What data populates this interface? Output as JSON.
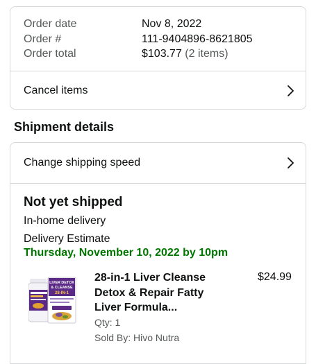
{
  "order_summary": {
    "rows": [
      {
        "label": "Order date",
        "value": "Nov 8, 2022"
      },
      {
        "label": "Order #",
        "value": "111-9404896-8621805"
      },
      {
        "label": "Order total",
        "value": "$103.77",
        "extra": "(2 items)"
      }
    ],
    "cancel_label": "Cancel items"
  },
  "shipment": {
    "heading": "Shipment details",
    "change_speed_label": "Change shipping speed",
    "status": "Not yet shipped",
    "delivery_type": "In-home delivery",
    "estimate_label": "Delivery Estimate",
    "estimate_date": "Thursday, November 10, 2022 by 10pm"
  },
  "product": {
    "title": "28-in-1 Liver Cleanse Detox & Repair Fatty Liver Formula...",
    "price": "$24.99",
    "qty": "Qty: 1",
    "sold_by": "Sold By: Hivo Nutra",
    "image_icon": "liver-supplement-bottle",
    "box_text_1": "LIVER DETOX",
    "box_text_2": "& CLEANSE",
    "box_text_3": "28-IN-1"
  },
  "colors": {
    "estimate_green": "#007600",
    "border": "#d5d9d9",
    "muted_text": "#565959"
  }
}
